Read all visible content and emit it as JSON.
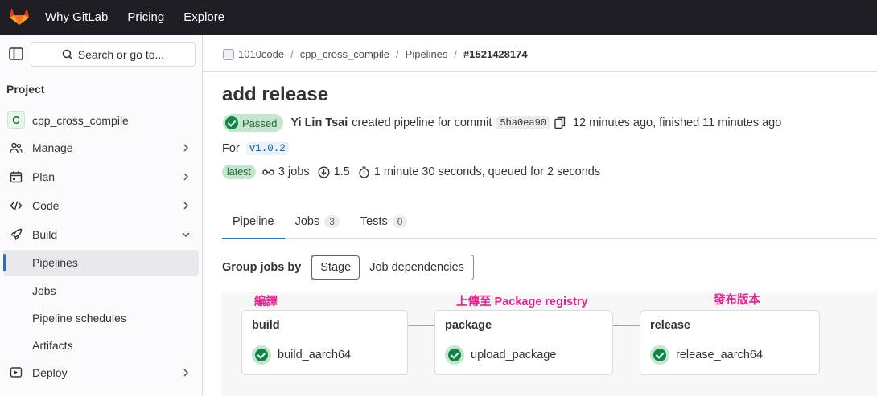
{
  "topnav": {
    "items": [
      "Why GitLab",
      "Pricing",
      "Explore"
    ]
  },
  "sidebar": {
    "search_label": "Search or go to...",
    "section": "Project",
    "project_initial": "C",
    "project_name": "cpp_cross_compile",
    "items": [
      {
        "label": "Manage",
        "icon": "users-icon"
      },
      {
        "label": "Plan",
        "icon": "calendar-icon"
      },
      {
        "label": "Code",
        "icon": "code-icon"
      },
      {
        "label": "Build",
        "icon": "rocket-icon"
      },
      {
        "label": "Pipelines"
      },
      {
        "label": "Jobs"
      },
      {
        "label": "Pipeline schedules"
      },
      {
        "label": "Artifacts"
      },
      {
        "label": "Deploy",
        "icon": "deploy-icon"
      }
    ]
  },
  "breadcrumb": [
    "1010code",
    "cpp_cross_compile",
    "Pipelines",
    "#1521428174"
  ],
  "pipeline": {
    "title": "add release",
    "status": "Passed",
    "author": "Yi Lin Tsai",
    "created_text": "created pipeline for commit",
    "commit": "5ba0ea90",
    "time_text": "12 minutes ago, finished 11 minutes ago",
    "for_label": "For",
    "ref": "v1.0.2",
    "latest_label": "latest",
    "jobs_count": "3 jobs",
    "version": "1.5",
    "duration": "1 minute 30 seconds, queued for 2 seconds"
  },
  "tabs": [
    {
      "label": "Pipeline"
    },
    {
      "label": "Jobs",
      "count": "3"
    },
    {
      "label": "Tests",
      "count": "0"
    }
  ],
  "groupby": {
    "label": "Group jobs by",
    "options": [
      "Stage",
      "Job dependencies"
    ],
    "selected": "Stage"
  },
  "graph": {
    "annotations": [
      "編譯",
      "上傳至 Package registry",
      "發布版本"
    ],
    "stages": [
      {
        "name": "build",
        "job": "build_aarch64"
      },
      {
        "name": "package",
        "job": "upload_package"
      },
      {
        "name": "release",
        "job": "release_aarch64"
      }
    ]
  },
  "colors": {
    "topbar": "#1f1e24",
    "accent": "#1f75cb",
    "success": "#108548",
    "annotation": "#e6218f"
  }
}
